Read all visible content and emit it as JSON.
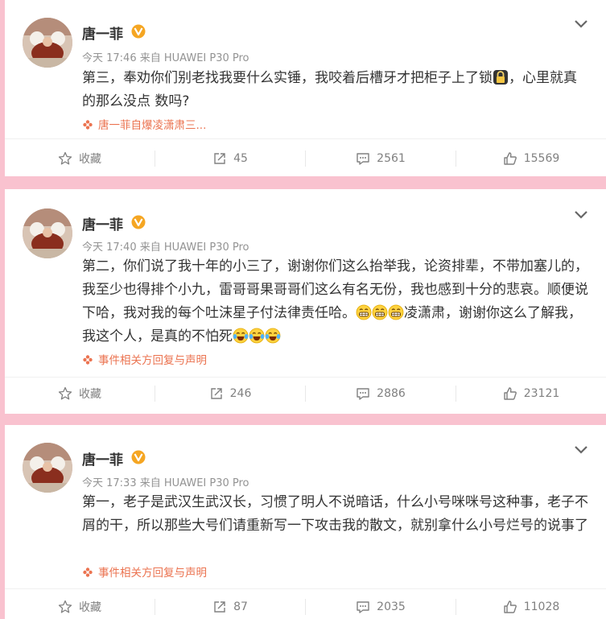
{
  "posts": [
    {
      "user": "唐一菲",
      "time": "今天 17:46 来自 HUAWEI P30 Pro",
      "text": "第三，奉劝你们别老找我要什么实锤，我咬着后槽牙才把柜子上了锁",
      "text_after_icon": "，心里就真的那么没点   数吗?",
      "tag": "唐一菲自爆凌潇肃三...",
      "actions": {
        "fav": "收藏",
        "share": "45",
        "comment": "2561",
        "like": "15569"
      }
    },
    {
      "user": "唐一菲",
      "time": "今天 17:40 来自 HUAWEI P30 Pro",
      "text": "第二，你们说了我十年的小三了，谢谢你们这么抬举我，论资排辈，不带加塞儿的，我至少也得排个小九，雷哥哥果哥哥们这么有名无份，我也感到十分的悲哀。顺便说下哈，我对我的每个吐沫星子付法律责任哈。",
      "text_mid": "凌潇肃，谢谢你这么了解我，我这个人，是真的不怕死",
      "tag": "事件相关方回复与声明",
      "actions": {
        "fav": "收藏",
        "share": "246",
        "comment": "2886",
        "like": "23121"
      }
    },
    {
      "user": "唐一菲",
      "time": "今天 17:33 来自 HUAWEI P30 Pro",
      "text": "第一，老子是武汉生武汉长，习惯了明人不说暗话，什么小号咪咪号这种事，老子不屑的干，所以那些大号们请重新写一下攻击我的散文，就别拿什么小号烂号的说事了",
      "tag": "事件相关方回复与声明",
      "actions": {
        "fav": "收藏",
        "share": "87",
        "comment": "2035",
        "like": "11028"
      }
    }
  ],
  "icons": [
    "avatar",
    "verified-badge-icon",
    "chevron-down-icon",
    "lock-icon",
    "grin-emoji-icon",
    "laugh-cry-emoji-icon",
    "flower-icon",
    "star-icon",
    "share-icon",
    "comment-icon",
    "thumbs-up-icon"
  ],
  "colors": {
    "background": "#f9c2cf",
    "badge": "#f5a623",
    "tag": "#eb7350",
    "meta": "#939393"
  }
}
